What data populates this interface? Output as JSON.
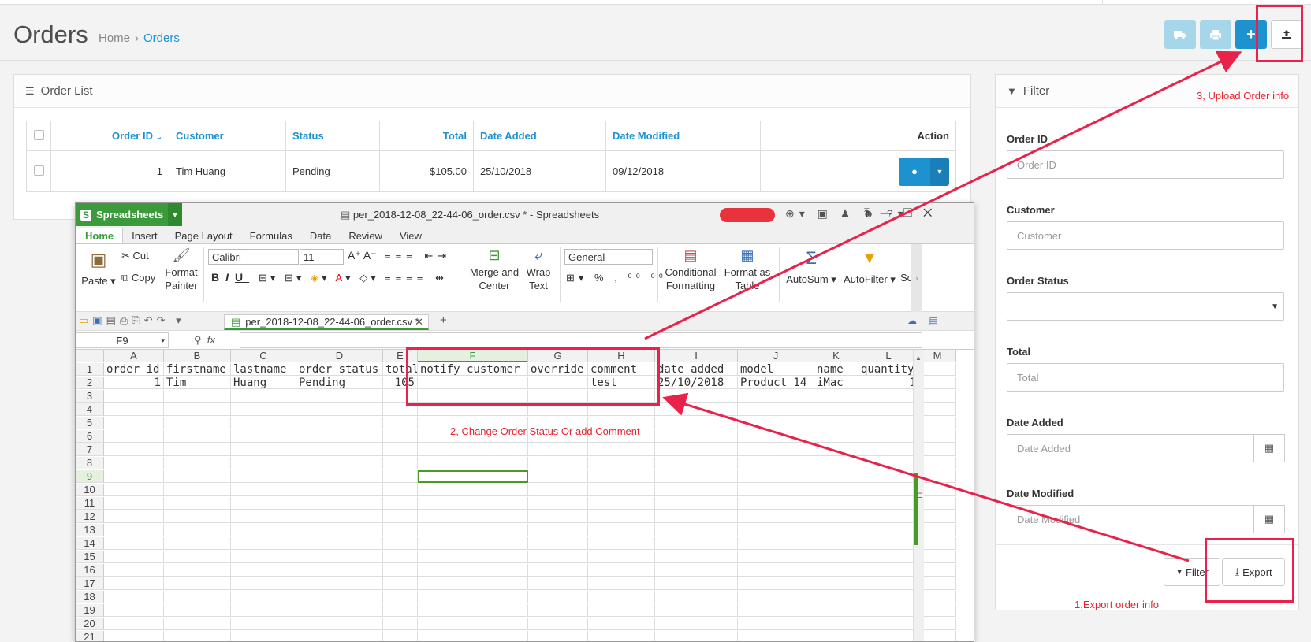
{
  "header": {
    "title": "Orders",
    "breadcrumb": [
      "Home",
      "Orders"
    ],
    "breadcrumb_sep": "›",
    "buttons": [
      "truck-icon",
      "print-icon",
      "plus-icon",
      "upload-icon"
    ]
  },
  "order_list": {
    "title": "Order List",
    "columns": [
      "Order ID",
      "Customer",
      "Status",
      "Total",
      "Date Added",
      "Date Modified",
      "Action"
    ],
    "rows": [
      {
        "order_id": "1",
        "customer": "Tim Huang",
        "status": "Pending",
        "total": "$105.00",
        "date_added": "25/10/2018",
        "date_modified": "09/12/2018"
      }
    ]
  },
  "filter": {
    "title": "Filter",
    "fields": [
      {
        "label": "Order ID",
        "placeholder": "Order ID"
      },
      {
        "label": "Customer",
        "placeholder": "Customer"
      },
      {
        "label": "Order Status",
        "placeholder": ""
      },
      {
        "label": "Total",
        "placeholder": "Total"
      },
      {
        "label": "Date Added",
        "placeholder": "Date Added"
      },
      {
        "label": "Date Modified",
        "placeholder": "Date Modified"
      }
    ],
    "filter_button": "Filter",
    "export_button": "Export"
  },
  "spreadsheet": {
    "brand": "Spreadsheets",
    "window_title": "per_2018-12-08_22-44-06_order.csv * - Spreadsheets",
    "menus": [
      "Home",
      "Insert",
      "Page Layout",
      "Formulas",
      "Data",
      "Review",
      "View"
    ],
    "ribbon": {
      "paste": "Paste",
      "cut": "Cut",
      "copy": "Copy",
      "format_painter": "Format Painter",
      "font": "Calibri",
      "size": "11",
      "merge": "Merge and Center",
      "wrap": "Wrap Text",
      "number_format": "General",
      "conditional": "Conditional Formatting",
      "format_table": "Format as Table",
      "autosum": "AutoSum",
      "autofilter": "AutoFilter",
      "sc": "Sc"
    },
    "doc_tab": "per_2018-12-08_22-44-06_order.csv *",
    "name_box": "F9",
    "fx": "fx",
    "columns": [
      "A",
      "B",
      "C",
      "D",
      "E",
      "F",
      "G",
      "H",
      "I",
      "J",
      "K",
      "L",
      "M"
    ],
    "rows": [
      [
        "order_id",
        "firstname",
        "lastname",
        "order_status",
        "total",
        "notify_customer",
        "override",
        "comment",
        "date_added",
        "model",
        "name",
        "quantity",
        ""
      ],
      [
        "1",
        "Tim",
        "Huang",
        "Pending",
        "105",
        "",
        "",
        "test",
        "25/10/2018",
        "Product 14",
        "iMac",
        "1",
        ""
      ]
    ],
    "row_numbers": [
      "1",
      "2",
      "3",
      "4",
      "5",
      "6",
      "7",
      "8",
      "9",
      "10",
      "11",
      "12",
      "13",
      "14",
      "15",
      "16",
      "17",
      "18",
      "19",
      "20",
      "21"
    ]
  },
  "annotations": {
    "step1": "1,Export order info",
    "step2": "2, Change Order Status  Or add Comment",
    "step3": "3, Upload Order info"
  }
}
